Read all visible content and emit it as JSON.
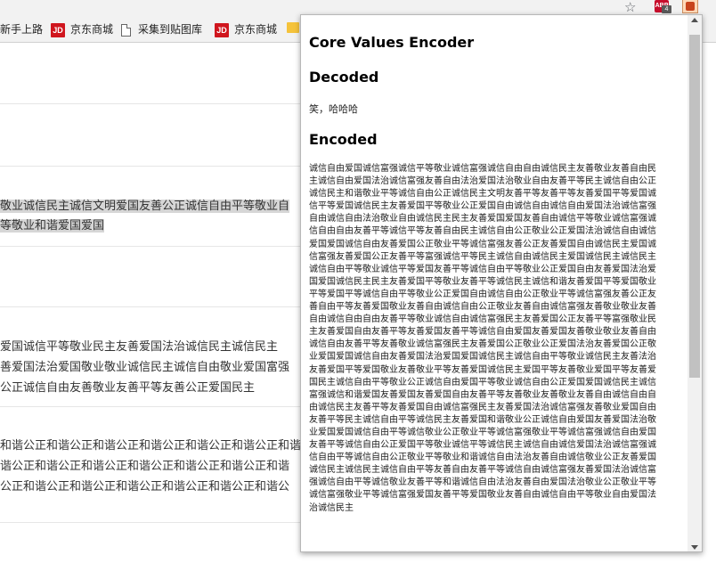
{
  "toolbar": {
    "star_icon": "star-icon",
    "extension_abp_label": "ABP",
    "extension_abp_badge": "4",
    "extension_encoder_icon": "core-values-encoder-icon"
  },
  "bookmarks": [
    {
      "label": "新手上路",
      "icon": "none"
    },
    {
      "label": "京东商城",
      "icon": "jd-icon"
    },
    {
      "label": "采集到贴图库",
      "icon": "page-icon"
    },
    {
      "label": "京东商城",
      "icon": "jd-icon"
    }
  ],
  "jd_icon_text": "JD",
  "page": {
    "block1": [
      "敬业诚信民主诚信文明爱国友善公正诚信自由平等敬业自",
      "等敬业和谐爱国爱国"
    ],
    "block2": [
      "爱国诚信平等敬业民主友善爱国法治诚信民主诚信民主",
      "善爱国法治爱国敬业敬业诚信民主诚信自由敬业爱国富强",
      "公正诚信自由友善敬业友善平等友善公正爱国民主"
    ],
    "block3": [
      "和谐公正和谐公正和谐公正和谐公正和谐公正和谐公正和谐",
      "谐公正和谐公正和谐公正和谐公正和谐公正和谐公正和谐",
      "公正和谐公正和谐公正和谐公正和谐公正和谐公正和谐公"
    ]
  },
  "popup": {
    "title": "Core Values Encoder",
    "decoded_heading": "Decoded",
    "decoded_text": "笑，哈哈哈",
    "encoded_heading": "Encoded",
    "encoded_text": "诚信自由爱国诚信富强诚信平等敬业诚信富强诚信自由自由诚信民主友善敬业友善自由民主诚信自由爱国法治诚信富强友善自由法治爱国法治敬业自由友善平等民主诚信自由公正诚信民主和谐敬业平等诚信自由公正诚信民主文明友善平等友善平等友善爱国平等爱国诚信平等爱国诚信民主友善爱国平等敬业公正爱国自由诚信自由诚信自由爱国法治诚信富强自由诚信自由法治敬业自由诚信民主民主友善爱国爱国友善自由诚信平等敬业诚信富强诚信自由自由友善平等诚信平等友善自由民主诚信自由公正敬业公正爱国法治诚信自由诚信爱国爱国诚信自由友善爱国公正敬业平等诚信富强友善公正友善爱国自由诚信民主爱国诚信富强友善爱国公正友善平等富强诚信平等民主诚信自由诚信民主爱国诚信民主诚信民主诚信自由平等敬业诚信平等爱国友善平等诚信自由平等敬业公正爱国自由友善爱国法治爱国爱国诚信民主民主友善爱国平等敬业友善平等诚信民主诚信和谐友善爱国平等爱国敬业平等爱国平等诚信自由平等敬业公正爱国自由诚信自由公正敬业平等诚信富强友善公正友善自由平等友善爱国敬业友善自由诚信自由公正敬业友善自由诚信富强友善敬业敬业友善自由诚信自由自由友善平等敬业诚信自由诚信富强民主友善爱国公正友善平等富强敬业民主友善爱国自由友善平等友善爱国友善平等诚信自由爱国友善爱国友善敬业敬业友善自由诚信自由友善平等友善敬业诚信富强民主友善爱国公正敬业公正爱国法治友善爱国公正敬业爱国爱国诚信自由友善爱国法治爱国爱国诚信民主诚信自由平等敬业诚信民主友善法治友善爱国平等爱国敬业友善敬业平等友善爱国诚信民主爱国平等友善敬业爱国平等友善爱国民主诚信自由平等敬业公正诚信自由爱国平等敬业诚信自由公正爱国爱国诚信民主诚信富强诚信和谐爱国友善爱国友善爱国自由友善平等友善敬业友善敬业友善自由诚信自由自由诚信民主友善平等友善爱国自由诚信富强民主友善爱国法治诚信富强友善敬业爱国自由友善平等民主诚信自由平等诚信民主友善爱国和谐敬业公正诚信自由爱国友善爱国法治敬业爱国爱国诚信自由平等诚信敬业公正敬业平等诚信富强敬业平等诚信富强诚信自由爱国友善平等诚信自由公正爱国平等敬业诚信平等诚信民主诚信自由诚信爱国法治诚信富强诚信自由平等诚信自由公正敬业平等敬业和谐诚信自由法治友善自由诚信敬业公正友善爱国诚信民主诚信民主诚信自由平等友善自由友善平等诚信自由诚信富强友善爱国法治诚信富强诚信自由平等诚信敬业友善平等和谐诚信自由法治友善自由爱国法治敬业公正敬业平等诚信富强敬业平等诚信富强爱国友善平等爱国敬业友善自由诚信自由平等敬业自由爱国法治诚信民主"
  }
}
